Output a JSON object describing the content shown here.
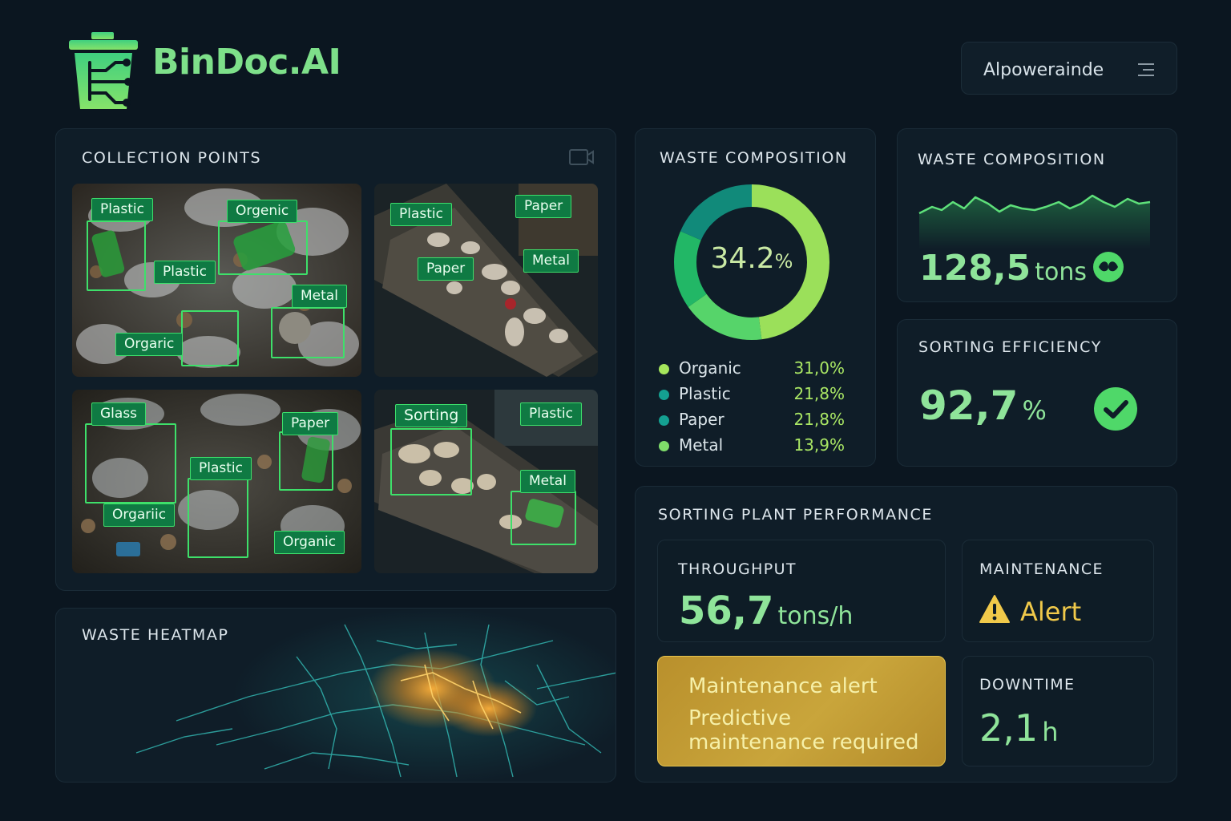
{
  "app": {
    "name": "BinDoc.AI",
    "user_label": "Alpowerainde"
  },
  "icons": {
    "logo": "trash-bin-circuit-icon",
    "menu": "menu-icon",
    "camera": "video-camera-icon",
    "tons_badge": "leaf-badge-icon",
    "efficiency_badge": "check-circle-icon",
    "maintenance": "warning-triangle-icon"
  },
  "colors": {
    "accent": "#7ee08a",
    "tag_fill": "#0f7a43",
    "tag_border": "#3dde6b",
    "warning": "#e6c44e",
    "background": "#0b1620"
  },
  "collection_points": {
    "title": "COLLECTION POINTS",
    "tiles": [
      {
        "tags": [
          "Plastic",
          "Orgenic",
          "Plastic",
          "Metal",
          "Orgaric"
        ]
      },
      {
        "tags": [
          "Plastic",
          "Paper",
          "Paper",
          "Metal"
        ]
      },
      {
        "tags": [
          "Glass",
          "Paper",
          "Plastic",
          "Orgariic",
          "Organic"
        ]
      },
      {
        "tags": [
          "Sorting",
          "Plastic",
          "Metal"
        ]
      }
    ]
  },
  "waste_composition_donut": {
    "title": "WASTE COMPOSITION",
    "center_value": "34.2",
    "center_unit": "%",
    "legend": [
      {
        "label": "Organic",
        "value": "31,0%",
        "color": "#a6e65c"
      },
      {
        "label": "Plastic",
        "value": "21,8%",
        "color": "#14a091"
      },
      {
        "label": "Paper",
        "value": "21,8%",
        "color": "#14a091"
      },
      {
        "label": "Metal",
        "value": "13,9%",
        "color": "#7fdc6a"
      }
    ]
  },
  "waste_composition_trend": {
    "title": "WASTE COMPOSITION",
    "value": "128,5",
    "unit": "tons"
  },
  "sorting_efficiency": {
    "title": "SORTING EFFICIENCY",
    "value": "92,7",
    "unit": "%"
  },
  "waste_heatmap": {
    "title": "WASTE HEATMAP"
  },
  "plant_performance": {
    "title": "SORTING PLANT PERFORMANCE",
    "throughput": {
      "label": "THROUGHPUT",
      "value": "56,7",
      "unit": "tons/h"
    },
    "maintenance": {
      "label": "MAINTENANCE",
      "status": "Alert"
    },
    "alert": {
      "line1": "Maintenance alert",
      "line2": "Predictive",
      "line3": "maintenance required"
    },
    "downtime": {
      "label": "DOWNTIME",
      "value": "2,1",
      "unit": "h"
    }
  }
}
